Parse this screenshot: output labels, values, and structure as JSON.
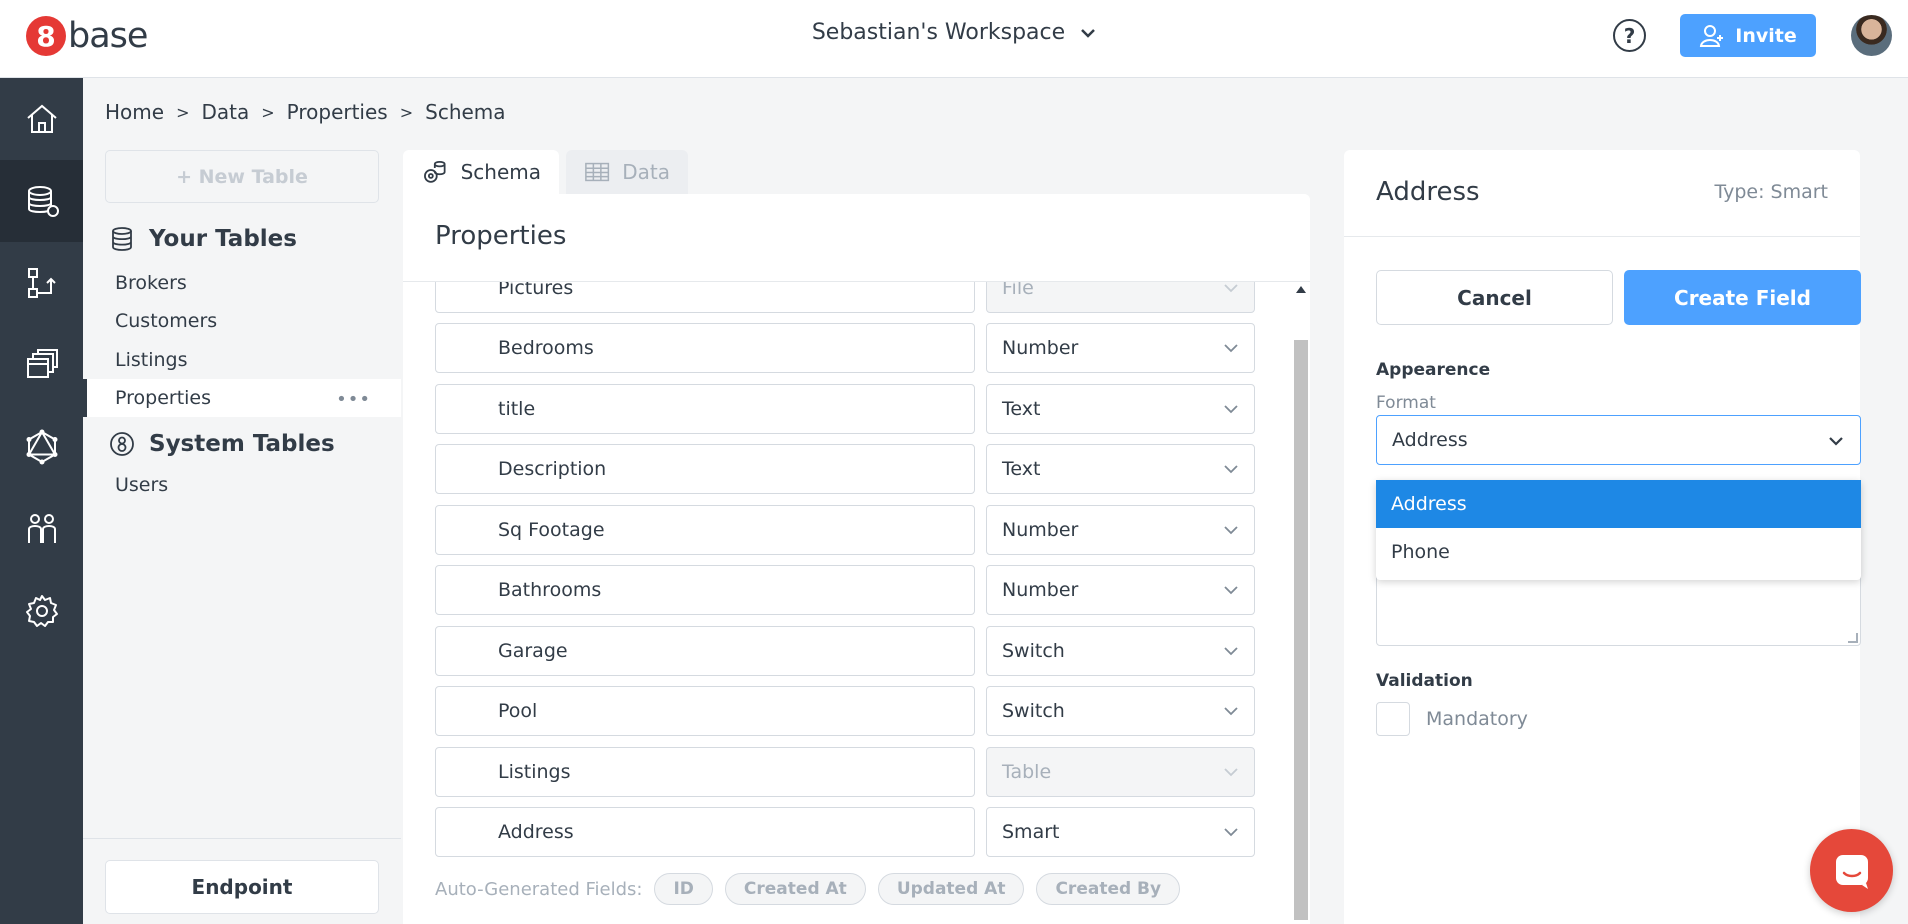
{
  "app": {
    "logo_mark": "8",
    "logo_text": "base",
    "workspace": "Sebastian's Workspace",
    "help": "?",
    "invite_label": "Invite"
  },
  "nav": [
    {
      "icon": "home-icon",
      "active": false
    },
    {
      "icon": "database-icon",
      "active": true
    },
    {
      "icon": "logic-flow-icon",
      "active": false
    },
    {
      "icon": "layers-icon",
      "active": false
    },
    {
      "icon": "graphql-icon",
      "active": false
    },
    {
      "icon": "team-icon",
      "active": false
    },
    {
      "icon": "gear-icon",
      "active": false
    }
  ],
  "breadcrumb": [
    "Home",
    "Data",
    "Properties",
    "Schema"
  ],
  "breadcrumb_sep": ">",
  "tables_sidebar": {
    "new_table_label": "+ New Table",
    "your_tables_title": "Your Tables",
    "your_tables": [
      "Brokers",
      "Customers",
      "Listings",
      "Properties"
    ],
    "active_table": "Properties",
    "more_label": "•••",
    "system_tables_title": "System Tables",
    "system_tables": [
      "Users"
    ],
    "endpoint_label": "Endpoint"
  },
  "tabs": [
    {
      "label": "Schema",
      "icon": "schema-icon",
      "active": true
    },
    {
      "label": "Data",
      "icon": "table-grid-icon",
      "active": false
    }
  ],
  "properties": {
    "title": "Properties",
    "fields": [
      {
        "name": "Pictures",
        "type": "File",
        "disabled": true
      },
      {
        "name": "Bedrooms",
        "type": "Number",
        "disabled": false
      },
      {
        "name": "title",
        "type": "Text",
        "disabled": false
      },
      {
        "name": "Description",
        "type": "Text",
        "disabled": false
      },
      {
        "name": "Sq Footage",
        "type": "Number",
        "disabled": false
      },
      {
        "name": "Bathrooms",
        "type": "Number",
        "disabled": false
      },
      {
        "name": "Garage",
        "type": "Switch",
        "disabled": false
      },
      {
        "name": "Pool",
        "type": "Switch",
        "disabled": false
      },
      {
        "name": "Listings",
        "type": "Table",
        "disabled": true
      },
      {
        "name": "Address",
        "type": "Smart",
        "disabled": false
      }
    ],
    "auto_generated_label": "Auto-Generated Fields:",
    "auto_generated_chips": [
      "ID",
      "Created At",
      "Updated At",
      "Created By"
    ]
  },
  "field_panel": {
    "title": "Address",
    "type_label": "Type: Smart",
    "cancel_label": "Cancel",
    "create_label": "Create Field",
    "appearance_label": "Appearence",
    "format_label": "Format",
    "format_value": "Address",
    "format_options": [
      "Address",
      "Phone"
    ],
    "selected_option": "Address",
    "validation_label": "Validation",
    "mandatory_label": "Mandatory"
  },
  "colors": {
    "accent": "#4da1ff",
    "nav_bg": "#323c47",
    "brand_red": "#e53935",
    "selected_option": "#1e88e5"
  }
}
